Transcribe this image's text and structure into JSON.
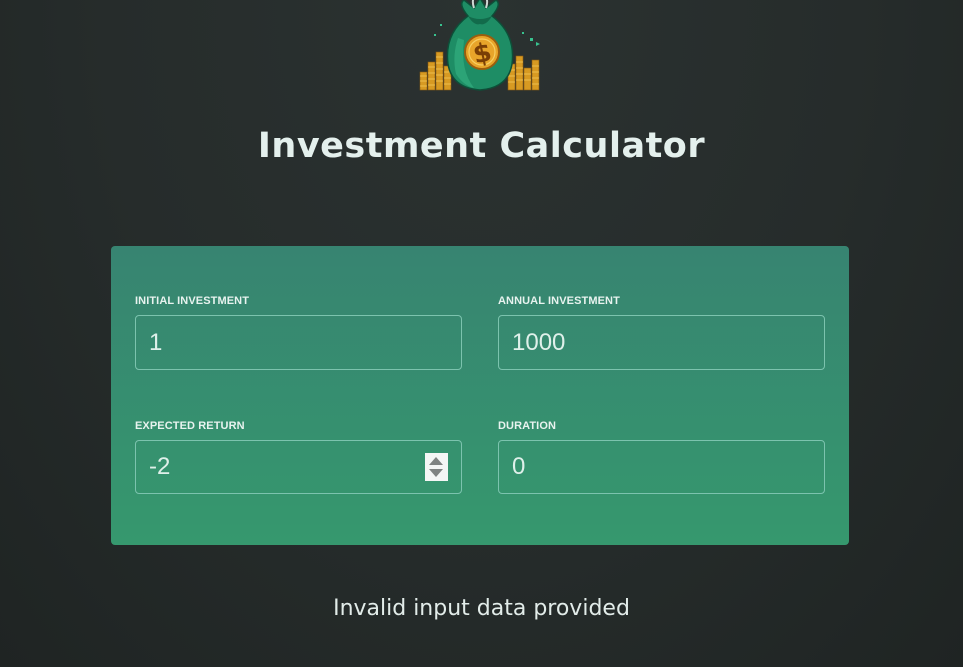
{
  "header": {
    "title": "Investment Calculator",
    "logo_icon": "money-bag-icon"
  },
  "form": {
    "initial_investment": {
      "label": "Initial Investment",
      "value": "1"
    },
    "annual_investment": {
      "label": "Annual Investment",
      "value": "1000"
    },
    "expected_return": {
      "label": "Expected Return",
      "value": "-2"
    },
    "duration": {
      "label": "Duration",
      "value": "0"
    }
  },
  "result": {
    "message": "Invalid input data provided"
  },
  "colors": {
    "background": "#272d2c",
    "panel_top": "#378471",
    "panel_bottom": "#36986e",
    "input_border": "#7cc3ae",
    "text": "#e4f0ed",
    "coin_gold": "#e2a72c",
    "bag_green": "#1d8a63"
  }
}
